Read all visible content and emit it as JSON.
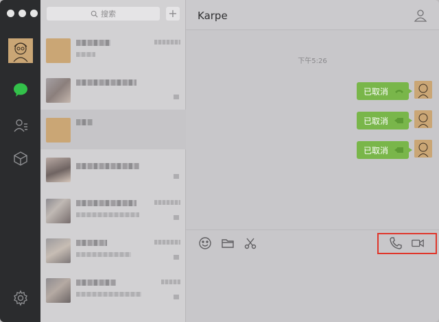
{
  "sidebar": {
    "icons": [
      "avatar",
      "chat-bubble-icon",
      "contacts-icon",
      "favorites-cube-icon",
      "gear-icon"
    ],
    "accent": "#33c14a"
  },
  "conversation_list": {
    "search_placeholder": "搜索",
    "add_label": "+"
  },
  "chat": {
    "title": "Karpe",
    "timestamp": "下午5:26",
    "messages": [
      {
        "text": "已取消",
        "type": "voice-call"
      },
      {
        "text": "已取消",
        "type": "video-call"
      },
      {
        "text": "已取消",
        "type": "video-call"
      }
    ],
    "bubble_color": "#79b64a",
    "highlight_color": "#e0352a"
  }
}
